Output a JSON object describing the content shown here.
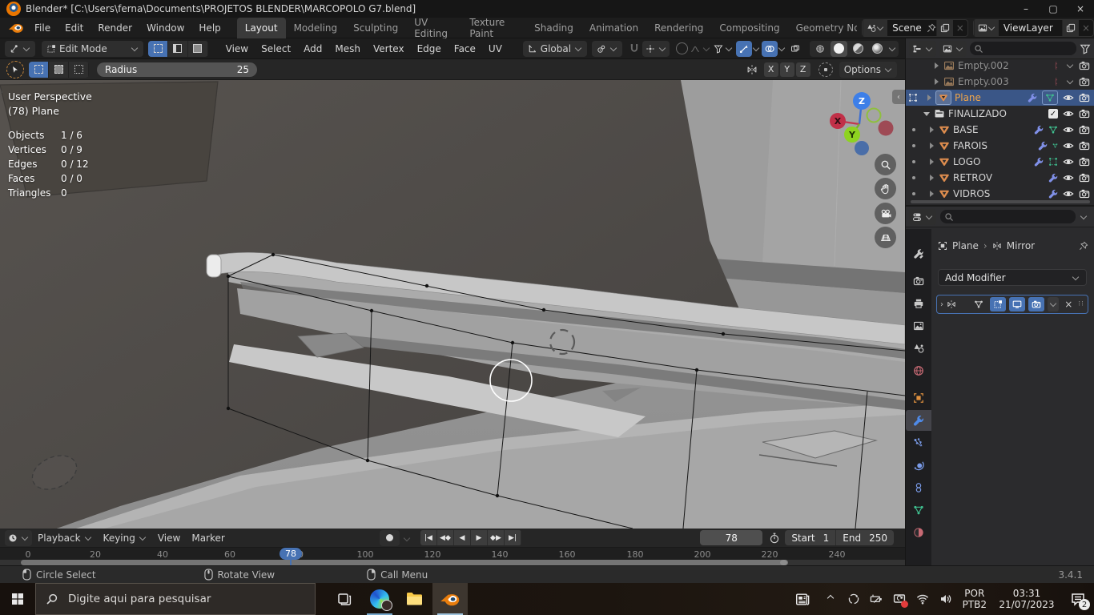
{
  "window": {
    "title": "Blender* [C:\\Users\\ferna\\Documents\\PROJETOS BLENDER\\MARCOPOLO G7.blend]"
  },
  "topbar": {
    "menus": [
      "File",
      "Edit",
      "Render",
      "Window",
      "Help"
    ],
    "tabs": [
      "Layout",
      "Modeling",
      "Sculpting",
      "UV Editing",
      "Texture Paint",
      "Shading",
      "Animation",
      "Rendering",
      "Compositing",
      "Geometry Node"
    ],
    "active_tab": "Layout",
    "scene_selector": {
      "value": "Scene"
    },
    "view_layer_selector": {
      "value": "ViewLayer"
    }
  },
  "viewport_header": {
    "mode": "Edit Mode",
    "menus": [
      "View",
      "Select",
      "Add",
      "Mesh",
      "Vertex",
      "Edge",
      "Face",
      "UV"
    ],
    "orientation": "Global"
  },
  "tool_settings": {
    "radius_label": "Radius",
    "radius_value": "25",
    "axes": [
      "X",
      "Y",
      "Z"
    ],
    "options_label": "Options"
  },
  "viewport": {
    "view_label": "User Perspective",
    "frame_object_label": "(78) Plane",
    "stats": [
      {
        "label": "Objects",
        "value": "1 / 6"
      },
      {
        "label": "Vertices",
        "value": "0 / 9"
      },
      {
        "label": "Edges",
        "value": "0 / 12"
      },
      {
        "label": "Faces",
        "value": "0 / 0"
      },
      {
        "label": "Triangles",
        "value": "0"
      }
    ],
    "gizmo_axes": {
      "x": "X",
      "y": "Y",
      "z": "Z"
    }
  },
  "outliner": {
    "rows": [
      {
        "name": "Empty.002",
        "type": "empty"
      },
      {
        "name": "Empty.003",
        "type": "empty"
      },
      {
        "name": "Plane",
        "type": "mesh",
        "selected": true
      },
      {
        "name": "FINALIZADO",
        "type": "collection"
      },
      {
        "name": "BASE",
        "type": "mesh"
      },
      {
        "name": "FAROIS",
        "type": "mesh"
      },
      {
        "name": "LOGO",
        "type": "mesh"
      },
      {
        "name": "RETROV",
        "type": "mesh"
      },
      {
        "name": "VIDROS",
        "type": "mesh"
      }
    ]
  },
  "properties": {
    "breadcrumb": {
      "object": "Plane",
      "modifier": "Mirror"
    },
    "add_modifier_label": "Add Modifier",
    "tab_icons": [
      "tool",
      "render",
      "output",
      "view-layer",
      "scene",
      "world",
      "object",
      "modifiers",
      "particles",
      "physics",
      "constraints",
      "object-data",
      "material"
    ]
  },
  "timeline": {
    "menus": [
      "Playback",
      "Keying",
      "View",
      "Marker"
    ],
    "ticks": [
      "0",
      "20",
      "40",
      "60",
      "80",
      "100",
      "120",
      "140",
      "160",
      "180",
      "200",
      "220",
      "240"
    ],
    "current_frame": "78",
    "start_label": "Start",
    "start_value": "1",
    "end_label": "End",
    "end_value": "250"
  },
  "statusbar": {
    "left": "Circle Select",
    "middle": "Rotate View",
    "right": "Call Menu",
    "version": "3.4.1"
  },
  "taskbar": {
    "search_placeholder": "Digite aqui para pesquisar",
    "language_line1": "POR",
    "language_line2": "PTB2",
    "time": "03:31",
    "date": "21/07/2023",
    "notification_count": "2",
    "icons": [
      "start",
      "search",
      "task-view",
      "edge",
      "file-explorer",
      "blender",
      "news",
      "tray-expand",
      "onedrive",
      "battery",
      "display-sync",
      "wifi",
      "volume",
      "language",
      "clock",
      "notifications"
    ]
  },
  "colors": {
    "accent_blue": "#4772b3",
    "selection_blue": "#3a5687",
    "active_text_orange": "#f0a54a",
    "mesh_icon_orange": "#de8d4e",
    "data_icon_green": "#3fbf8f",
    "modifier_wrench_blue": "#8090e8"
  }
}
